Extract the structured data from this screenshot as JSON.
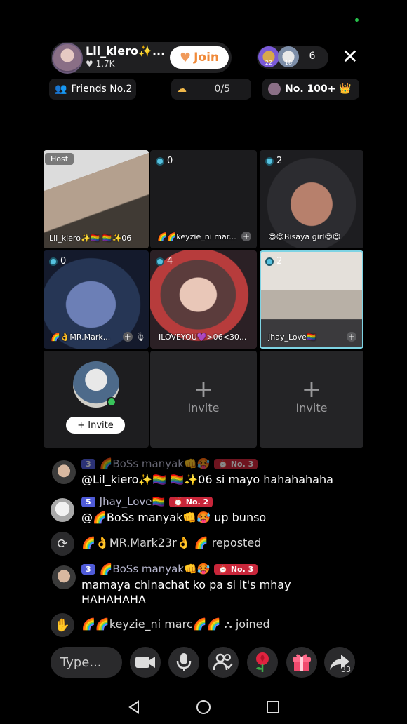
{
  "header": {
    "host_name": "Lil_kiero✨...",
    "host_likes": "♥ 1.7K",
    "join_label": "Join",
    "viewer_badges": [
      "22",
      "18"
    ],
    "viewer_count": "6"
  },
  "stats": {
    "friends": "Friends No.2",
    "progress": "0/5",
    "rank": "No. 100+ 👑"
  },
  "grid": {
    "host_tag": "Host",
    "tiles": [
      {
        "name": "Lil_kiero✨🏳️‍🌈 🏳️‍🌈✨06",
        "count": ""
      },
      {
        "name": "🌈🌈keyzie_ni mar...",
        "count": "0"
      },
      {
        "name": "😍😍Bisaya girl😍😍",
        "count": "2"
      },
      {
        "name": "🌈👌MR.Mark...",
        "count": "0"
      },
      {
        "name": "ILOVEYOU💜>06<30...",
        "count": "4"
      },
      {
        "name": "Jhay_Love🏳️‍🌈",
        "count": "2"
      }
    ],
    "invite_pill": "+ Invite",
    "invite_label": "Invite"
  },
  "chat": [
    {
      "level": "3",
      "user": "🌈BoSs manyak👊🥵",
      "rank": "⏰ No. 3",
      "text": "@Lil_kiero✨🏳️‍🌈 🏳️‍🌈✨06 si mayo hahahahaha"
    },
    {
      "level": "5",
      "user": "Jhay_Love🏳️‍🌈",
      "rank": "⏰ No. 2",
      "text": "@🌈BoSs manyak👊🥵 up bunso"
    },
    {
      "system": "🌈👌MR.Mark23r👌 🌈 reposted"
    },
    {
      "level": "3",
      "user": "🌈BoSs manyak👊🥵",
      "rank": "⏰ No. 3",
      "text_line1": "mamaya chinachat ko pa si it's mhay",
      "text_line2": "HAHAHAHA"
    },
    {
      "system": "🌈🌈keyzie_ni marc🌈🌈 ⛬ joined"
    }
  ],
  "toolbar": {
    "type_placeholder": "Type...",
    "share_count": "33"
  },
  "colors": {
    "background": "#000000",
    "accent_join": "#f08a3a",
    "level_badge": "#4f5bd8",
    "rank_badge": "#c8263a",
    "online": "#39c45b"
  },
  "icons": [
    "close-icon",
    "users-icon",
    "cloud-icon",
    "crown-icon",
    "camera-icon",
    "mic-icon",
    "guests-icon",
    "rose-icon",
    "gift-icon",
    "share-icon",
    "repost-icon",
    "wave-icon",
    "back-icon",
    "home-icon",
    "recents-icon"
  ]
}
